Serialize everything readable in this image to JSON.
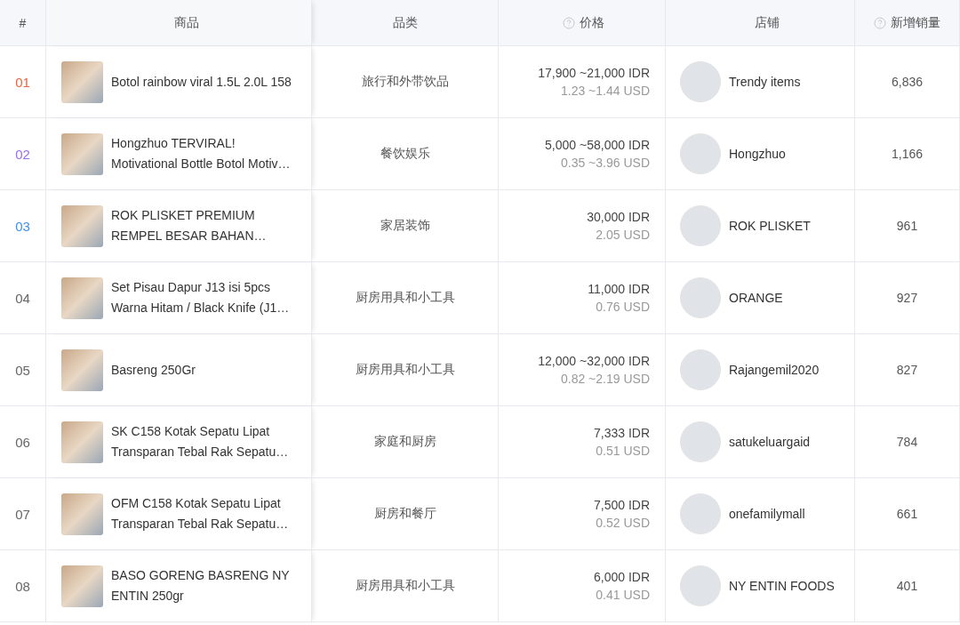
{
  "table": {
    "columns": [
      {
        "label": "#",
        "help": false
      },
      {
        "label": "商品",
        "help": false
      },
      {
        "label": "品类",
        "help": false
      },
      {
        "label": "价格",
        "help": true
      },
      {
        "label": "店铺",
        "help": false
      },
      {
        "label": "新增销量",
        "help": true
      }
    ],
    "rows": [
      {
        "rank": "01",
        "color": "#f0643c",
        "product": "Botol rainbow viral 1.5L 2.0L 158",
        "category": "旅行和外带饮品",
        "price_idr": "17,900 ~21,000 IDR",
        "price_usd": "1.23 ~1.44 USD",
        "shop": "Trendy items",
        "sales": "6,836"
      },
      {
        "rank": "02",
        "color": "#9b6cf0",
        "product": "Hongzhuo TERVIRAL! Motivational Bottle Botol Motiv…",
        "category": "餐饮娱乐",
        "price_idr": "5,000 ~58,000 IDR",
        "price_usd": "0.35 ~3.96 USD",
        "shop": "Hongzhuo",
        "sales": "1,166"
      },
      {
        "rank": "03",
        "color": "#3d8ff0",
        "product": "ROK PLISKET PREMIUM REMPEL BESAR BAHAN…",
        "category": "家居装饰",
        "price_idr": "30,000 IDR",
        "price_usd": "2.05 USD",
        "shop": "ROK PLISKET",
        "sales": "961"
      },
      {
        "rank": "04",
        "color": "#666666",
        "product": "Set Pisau Dapur J13 isi 5pcs Warna Hitam / Black Knife (J1…",
        "category": "厨房用具和小工具",
        "price_idr": "11,000 IDR",
        "price_usd": "0.76 USD",
        "shop": "ORANGE",
        "sales": "927"
      },
      {
        "rank": "05",
        "color": "#666666",
        "product": "Basreng 250Gr",
        "category": "厨房用具和小工具",
        "price_idr": "12,000 ~32,000 IDR",
        "price_usd": "0.82 ~2.19 USD",
        "shop": "Rajangemil2020",
        "sales": "827"
      },
      {
        "rank": "06",
        "color": "#666666",
        "product": "SK C158 Kotak Sepatu Lipat Transparan Tebal Rak Sepatu…",
        "category": "家庭和厨房",
        "price_idr": "7,333 IDR",
        "price_usd": "0.51 USD",
        "shop": "satukeluargaid",
        "sales": "784"
      },
      {
        "rank": "07",
        "color": "#666666",
        "product": "OFM C158 Kotak Sepatu Lipat Transparan Tebal Rak Sepatu…",
        "category": "厨房和餐厅",
        "price_idr": "7,500 IDR",
        "price_usd": "0.52 USD",
        "shop": "onefamilymall",
        "sales": "661"
      },
      {
        "rank": "08",
        "color": "#666666",
        "product": "BASO GORENG BASRENG NY ENTIN 250gr",
        "category": "厨房用具和小工具",
        "price_idr": "6,000 IDR",
        "price_usd": "0.41 USD",
        "shop": "NY ENTIN FOODS",
        "sales": "401"
      }
    ]
  }
}
